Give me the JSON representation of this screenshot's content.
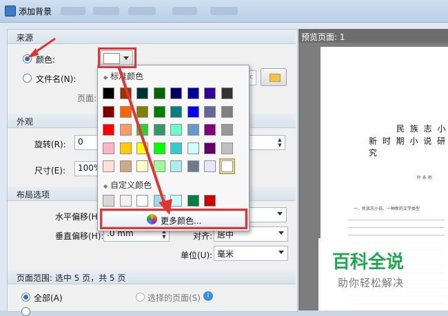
{
  "window": {
    "title": "添加背景"
  },
  "source": {
    "header": "来源",
    "color_label": "颜色:",
    "file_label": "文件名(N):",
    "page_label": "页面:"
  },
  "appearance": {
    "header": "外观",
    "rotate_label": "旋转(R):",
    "rotate_value": "0",
    "size_label": "尺寸(E):",
    "size_value": "100%"
  },
  "layout": {
    "header": "布局选项",
    "h_offset_label": "水平偏移(H)",
    "v_offset_label": "垂直偏移(H):",
    "v_offset_value": ".0 mm",
    "align_label": "对齐:",
    "align_value": "居中",
    "unit_label": "单位(U):",
    "unit_value": "毫米"
  },
  "page_range": {
    "header": "页面范围: 选中 5 页，共 5 页",
    "all_label": "全部(A)",
    "selected_label": "选择的页面(S)"
  },
  "preview": {
    "title": "预览页面: 1",
    "line1": "民 族 志 小",
    "line2": "新 时 期 小 说 研 究",
    "author": "叶 永 烈",
    "section": "一、民族志小说、一种新的文学类型"
  },
  "color_picker": {
    "standard_header": "标准颜色",
    "custom_header": "自定义颜色",
    "more_label": "更多颜色...",
    "standard_colors": [
      [
        "#000000",
        "#993300",
        "#003333",
        "#006600",
        "#000066",
        "#000099",
        "#330099",
        "#333333"
      ],
      [
        "#800000",
        "#ff6600",
        "#808000",
        "#008000",
        "#008080",
        "#0000ff",
        "#666699",
        "#808080"
      ],
      [
        "#ff0000",
        "#ff9966",
        "#33cc33",
        "#339966",
        "#66ffcc",
        "#6699cc",
        "#800080",
        "#999999"
      ],
      [
        "#ffb3c6",
        "#ffcc00",
        "#ffff00",
        "#00ff00",
        "#33cccc",
        "#ccffff",
        "#660066",
        "#c0c0c0"
      ],
      [
        "#ffe0d6",
        "#ccaa88",
        "#ffffcc",
        "#99ff99",
        "#aaeeee",
        "#6d7b8a",
        "#e6e6ff",
        "#ffffff"
      ]
    ],
    "custom_colors": [
      "#d9d9d9",
      "#f2f2f2",
      "#ffffff",
      "#99ddee",
      "#ccffff",
      "#008040",
      "#cc0000"
    ]
  },
  "watermark": {
    "brand": "百科全说",
    "slogan": "助你轻松解决"
  },
  "colors": {
    "accent": "#2a6fd3",
    "highlight": "#e23434",
    "brand_green": "#1fa84f"
  }
}
